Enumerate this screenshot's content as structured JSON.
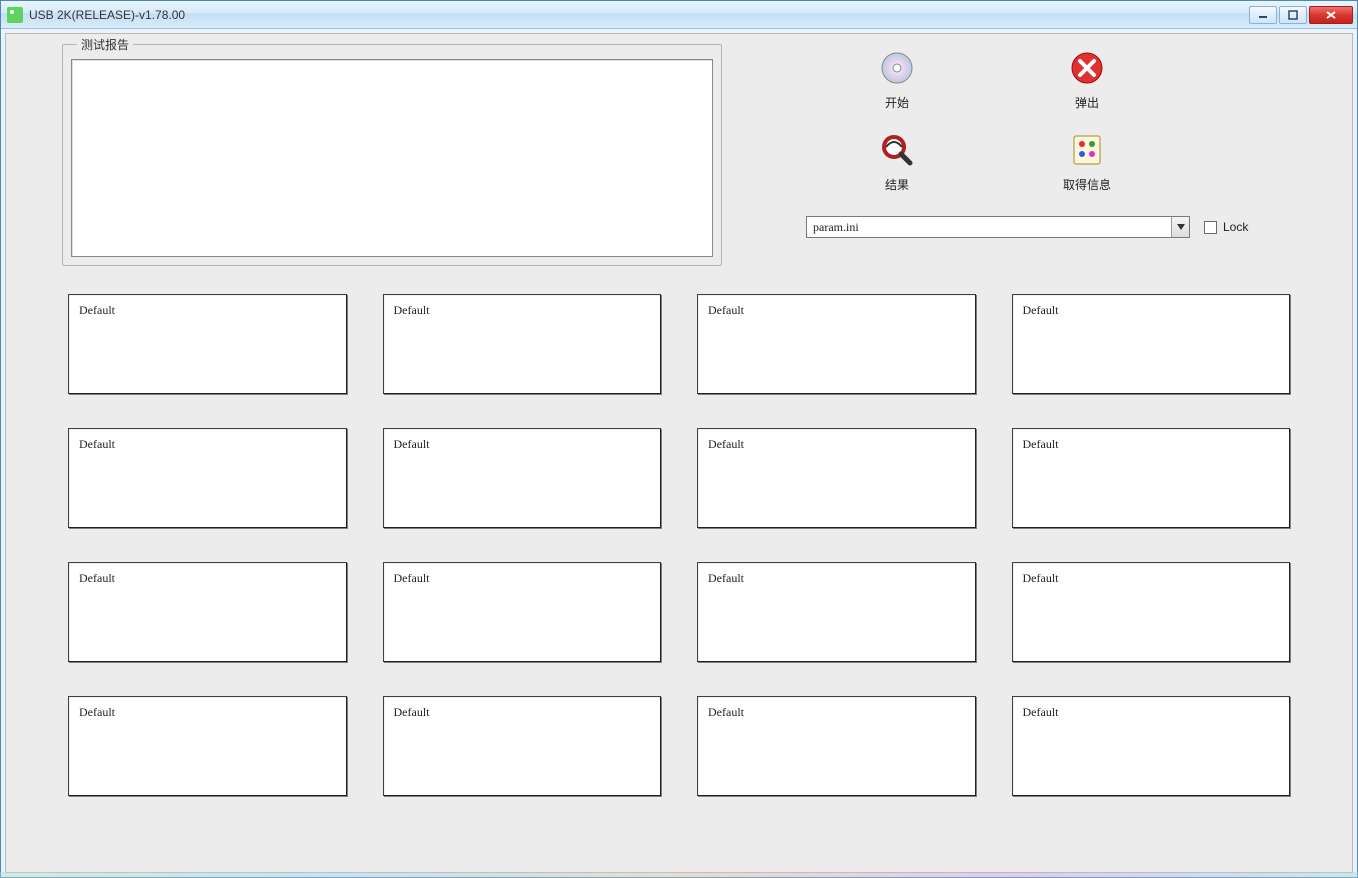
{
  "window": {
    "title": "USB 2K(RELEASE)-v1.78.00"
  },
  "groupbox": {
    "legend": "测试报告",
    "report_text": ""
  },
  "buttons": {
    "start": "开始",
    "eject": "弹出",
    "result": "结果",
    "getinfo": "取得信息"
  },
  "dropdown": {
    "value": "param.ini"
  },
  "lock": {
    "label": "Lock",
    "checked": false
  },
  "slots": [
    {
      "label": "Default"
    },
    {
      "label": "Default"
    },
    {
      "label": "Default"
    },
    {
      "label": "Default"
    },
    {
      "label": "Default"
    },
    {
      "label": "Default"
    },
    {
      "label": "Default"
    },
    {
      "label": "Default"
    },
    {
      "label": "Default"
    },
    {
      "label": "Default"
    },
    {
      "label": "Default"
    },
    {
      "label": "Default"
    },
    {
      "label": "Default"
    },
    {
      "label": "Default"
    },
    {
      "label": "Default"
    },
    {
      "label": "Default"
    }
  ]
}
